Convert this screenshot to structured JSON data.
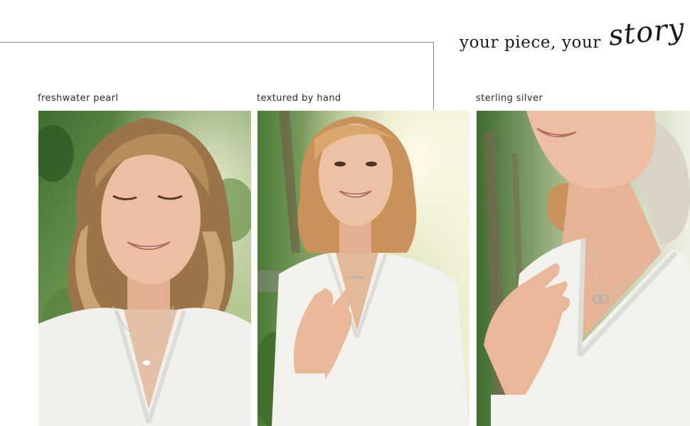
{
  "headline": {
    "main": "your piece, your",
    "script": "story"
  },
  "photos": [
    {
      "caption": "freshwater pearl",
      "icon": "portrait-photo"
    },
    {
      "caption": "textured by hand",
      "icon": "portrait-photo"
    },
    {
      "caption": "sterling silver",
      "icon": "closeup-photo"
    }
  ],
  "colors": {
    "background": "#ffffff",
    "frame_line": "#8a8a8a",
    "text": "#1a1a1a",
    "foliage": "#4f7a3a",
    "blouse": "#f2f1ee",
    "hair": "#b08a5e",
    "skin": "#e8b89a"
  }
}
